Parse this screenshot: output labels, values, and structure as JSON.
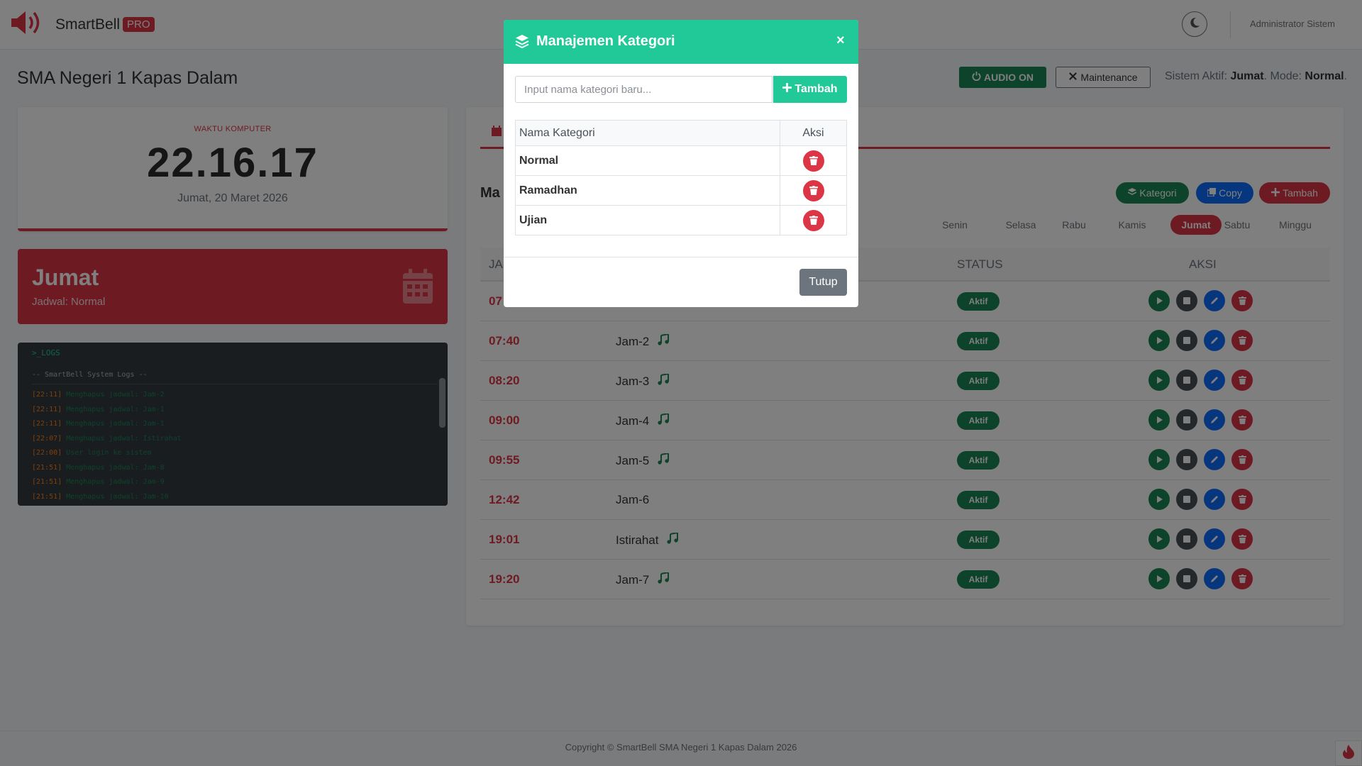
{
  "navbar": {
    "brand": "SmartBell",
    "badge": "PRO",
    "user": "Administrator Sistem"
  },
  "header": {
    "school": "SMA Negeri 1 Kapas Dalam",
    "audio_btn": "AUDIO ON",
    "maintenance_btn": "Maintenance",
    "status_prefix": "Sistem Aktif:",
    "status_day": "Jumat",
    "status_mode_label": ". Mode:",
    "status_mode": "Normal",
    "status_end": "."
  },
  "clock": {
    "label": "WAKTU KOMPUTER",
    "time": "22.16.17",
    "date": "Jumat, 20 Maret 2026"
  },
  "day_card": {
    "day": "Jumat",
    "schedule": "Jadwal: Normal"
  },
  "logs": {
    "title": ">_LOGS",
    "header": "-- SmartBell System Logs --",
    "entries": [
      {
        "time": "[22:11]",
        "msg": "Menghapus jadwal: Jam-2"
      },
      {
        "time": "[22:11]",
        "msg": "Menghapus jadwal: Jam-1"
      },
      {
        "time": "[22:11]",
        "msg": "Menghapus jadwal: Jam-1"
      },
      {
        "time": "[22:07]",
        "msg": "Menghapus jadwal: Istirahat"
      },
      {
        "time": "[22:00]",
        "msg": "User login ke sistem"
      },
      {
        "time": "[21:51]",
        "msg": "Menghapus jadwal: Jam-8"
      },
      {
        "time": "[21:51]",
        "msg": "Menghapus jadwal: Jam-9"
      },
      {
        "time": "[21:51]",
        "msg": "Menghapus jadwal: Jam-10"
      }
    ]
  },
  "panel": {
    "title_partial": "Ma",
    "btn_kategori": "Kategori",
    "btn_copy": "Copy",
    "btn_tambah": "Tambah",
    "days": [
      {
        "label": "Senin",
        "active": false
      },
      {
        "label": "Selasa",
        "active": false
      },
      {
        "label": "Rabu",
        "active": false
      },
      {
        "label": "Kamis",
        "active": false
      },
      {
        "label": "Jumat",
        "active": true
      },
      {
        "label": "Sabtu",
        "active": false
      },
      {
        "label": "Minggu",
        "active": false
      }
    ],
    "columns": {
      "jam": "JA",
      "status": "STATUS",
      "aksi": "AKSI"
    },
    "rows": [
      {
        "time": "07",
        "name": "",
        "music": false,
        "status": "Aktif"
      },
      {
        "time": "07:40",
        "name": "Jam-2",
        "music": true,
        "status": "Aktif"
      },
      {
        "time": "08:20",
        "name": "Jam-3",
        "music": true,
        "status": "Aktif"
      },
      {
        "time": "09:00",
        "name": "Jam-4",
        "music": true,
        "status": "Aktif"
      },
      {
        "time": "09:55",
        "name": "Jam-5",
        "music": true,
        "status": "Aktif"
      },
      {
        "time": "12:42",
        "name": "Jam-6",
        "music": false,
        "status": "Aktif"
      },
      {
        "time": "19:01",
        "name": "Istirahat",
        "music": true,
        "status": "Aktif"
      },
      {
        "time": "19:20",
        "name": "Jam-7",
        "music": true,
        "status": "Aktif"
      }
    ]
  },
  "footer": {
    "text": "Copyright © SmartBell SMA Negeri 1 Kapas Dalam 2026"
  },
  "modal": {
    "title": "Manajemen Kategori",
    "close": "×",
    "input_placeholder": "Input nama kategori baru...",
    "add_btn": "Tambah",
    "col_name": "Nama Kategori",
    "col_action": "Aksi",
    "categories": [
      "Normal",
      "Ramadhan",
      "Ujian"
    ],
    "close_btn": "Tutup"
  },
  "colors": {
    "accent": "#dc3545",
    "success": "#198754",
    "modal_header": "#20c997",
    "primary": "#0d6efd"
  }
}
